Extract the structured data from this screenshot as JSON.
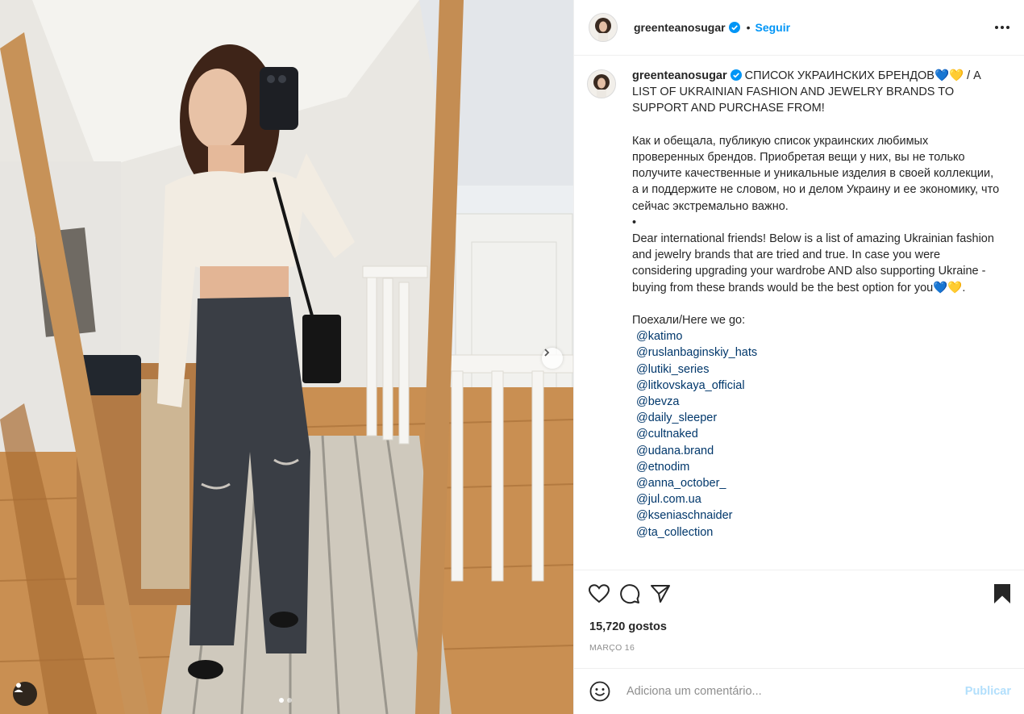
{
  "post": {
    "username": "greenteanosugar",
    "verified": true,
    "bullet": "•",
    "follow_label": "Seguir",
    "more_icon": "more-options-icon"
  },
  "caption": {
    "text": " СПИСОК УКРАИНСКИХ БРЕНДОВ💙💛 / A LIST OF UKRAINIAN FASHION AND JEWELRY BRANDS TO SUPPORT AND PURCHASE FROM!\n\nКак и обещала, публикую список украинских любимых проверенных брендов. Приобретая вещи у них, вы не только получите качественные и уникальные изделия в своей коллекции, а и поддержите не словом, но и делом Украину и ее экономику, что сейчас экстремально важно.\n•\nDear international friends! Below is a list of amazing Ukrainian fashion and jewelry brands that are tried and true. In case you were considering upgrading your wardrobe AND also supporting Ukraine - buying from these brands would be the best option for you💙💛.\n\nПоехали/Here we go:\n",
    "mentions": [
      "@katimo",
      "@ruslanbaginskiy_hats",
      "@lutiki_series",
      "@litkovskaya_official",
      "@bevza",
      "@daily_sleeper",
      "@cultnaked",
      "@udana.brand",
      "@etnodim",
      "@anna_october_",
      "@jul.com.ua",
      "@kseniaschnaider",
      "@ta_collection"
    ]
  },
  "actions": {
    "like_icon": "heart-icon",
    "comment_icon": "comment-icon",
    "share_icon": "share-icon",
    "save_icon": "bookmark-icon"
  },
  "likes": "15,720 gostos",
  "date": "MARÇO 16",
  "comment": {
    "placeholder": "Adiciona um comentário...",
    "publish_label": "Publicar"
  },
  "carousel": {
    "slides": 2,
    "active_index": 0
  },
  "colors": {
    "accent": "#0095f6",
    "mention": "#00376b",
    "publish_disabled": "#b2dffc",
    "muted": "#8e8e8e"
  }
}
